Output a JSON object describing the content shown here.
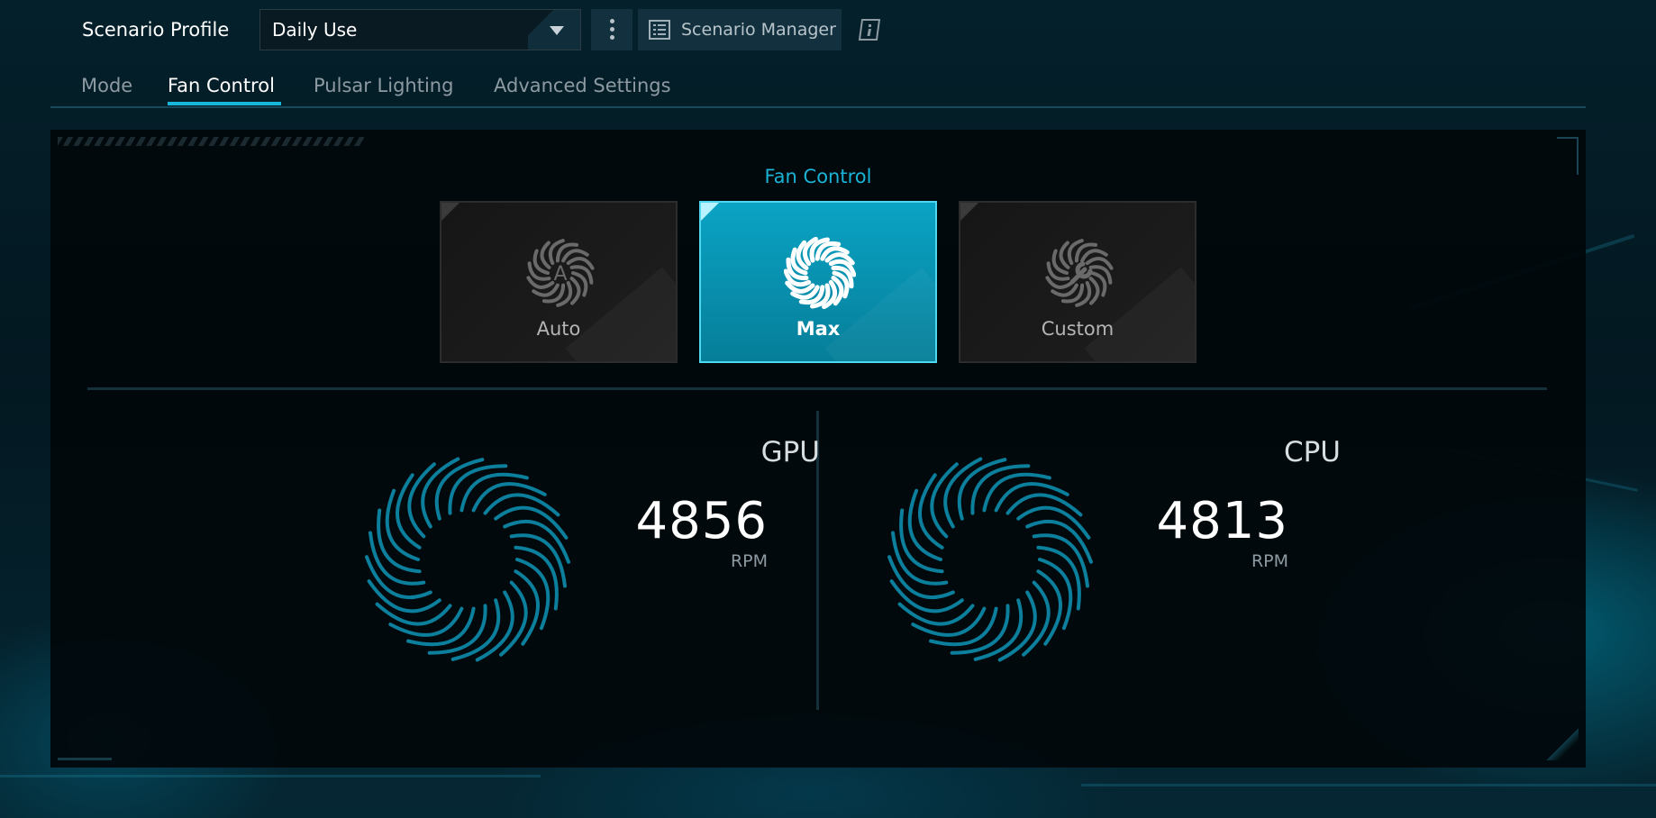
{
  "header": {
    "profile_label": "Scenario Profile",
    "profile_value": "Daily Use",
    "scenario_manager_label": "Scenario Manager"
  },
  "tabs": [
    {
      "label": "Mode",
      "active": false
    },
    {
      "label": "Fan Control",
      "active": true
    },
    {
      "label": "Pulsar Lighting",
      "active": false
    },
    {
      "label": "Advanced Settings",
      "active": false
    }
  ],
  "fan_control": {
    "title": "Fan Control",
    "modes": [
      {
        "label": "Auto",
        "icon": "fan-auto-icon",
        "selected": false
      },
      {
        "label": "Max",
        "icon": "fan-max-icon",
        "selected": true
      },
      {
        "label": "Custom",
        "icon": "fan-custom-icon",
        "selected": false
      }
    ]
  },
  "fans": [
    {
      "name": "GPU",
      "rpm": "4856",
      "unit": "RPM"
    },
    {
      "name": "CPU",
      "rpm": "4813",
      "unit": "RPM"
    }
  ],
  "colors": {
    "accent": "#16b7da",
    "active_card": "#0aa3c4",
    "fan_blade": "#0c7f9c"
  }
}
